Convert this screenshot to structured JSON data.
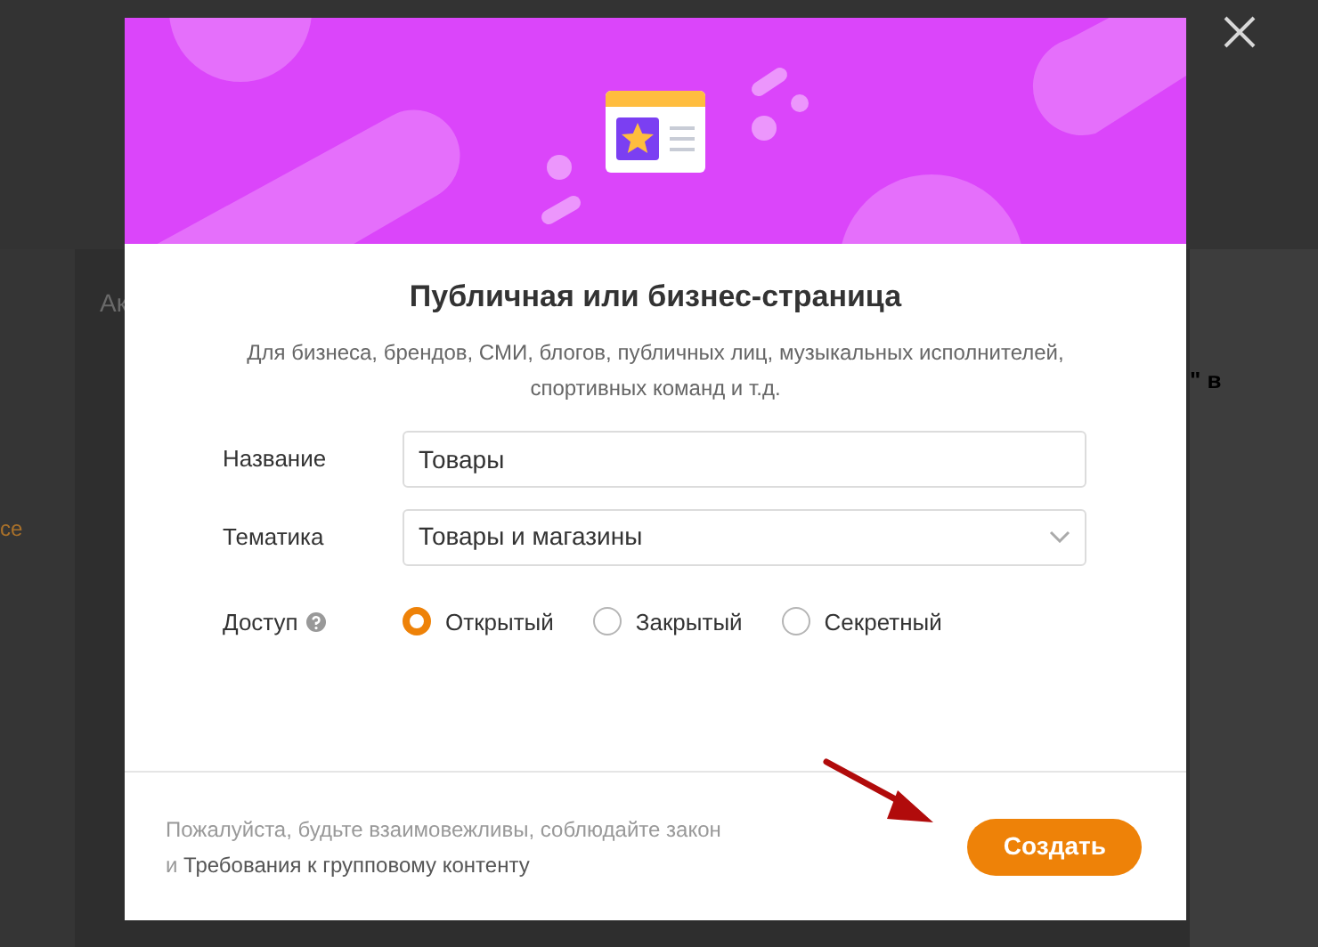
{
  "background": {
    "tab_fragment": "Ак",
    "left_fragment": "се",
    "right_fragment": "\" в"
  },
  "dialog": {
    "title": "Публичная или бизнес-страница",
    "description": "Для бизнеса, брендов, СМИ, блогов, публичных лиц, музыкальных исполнителей, спортивных команд и т.д.",
    "fields": [
      {
        "kind": "text",
        "label": "Название",
        "value": "Товары"
      },
      {
        "kind": "select",
        "label": "Тематика",
        "value": "Товары и магазины"
      }
    ],
    "access": {
      "label": "Доступ",
      "options": [
        {
          "label": "Открытый",
          "selected": true
        },
        {
          "label": "Закрытый",
          "selected": false
        },
        {
          "label": "Секретный",
          "selected": false
        }
      ]
    },
    "footer": {
      "notice": "Пожалуйста, будьте взаимовежливы, соблюдайте закон",
      "conjunction": "и",
      "link": "Требования к групповому контенту",
      "button": "Создать"
    }
  }
}
